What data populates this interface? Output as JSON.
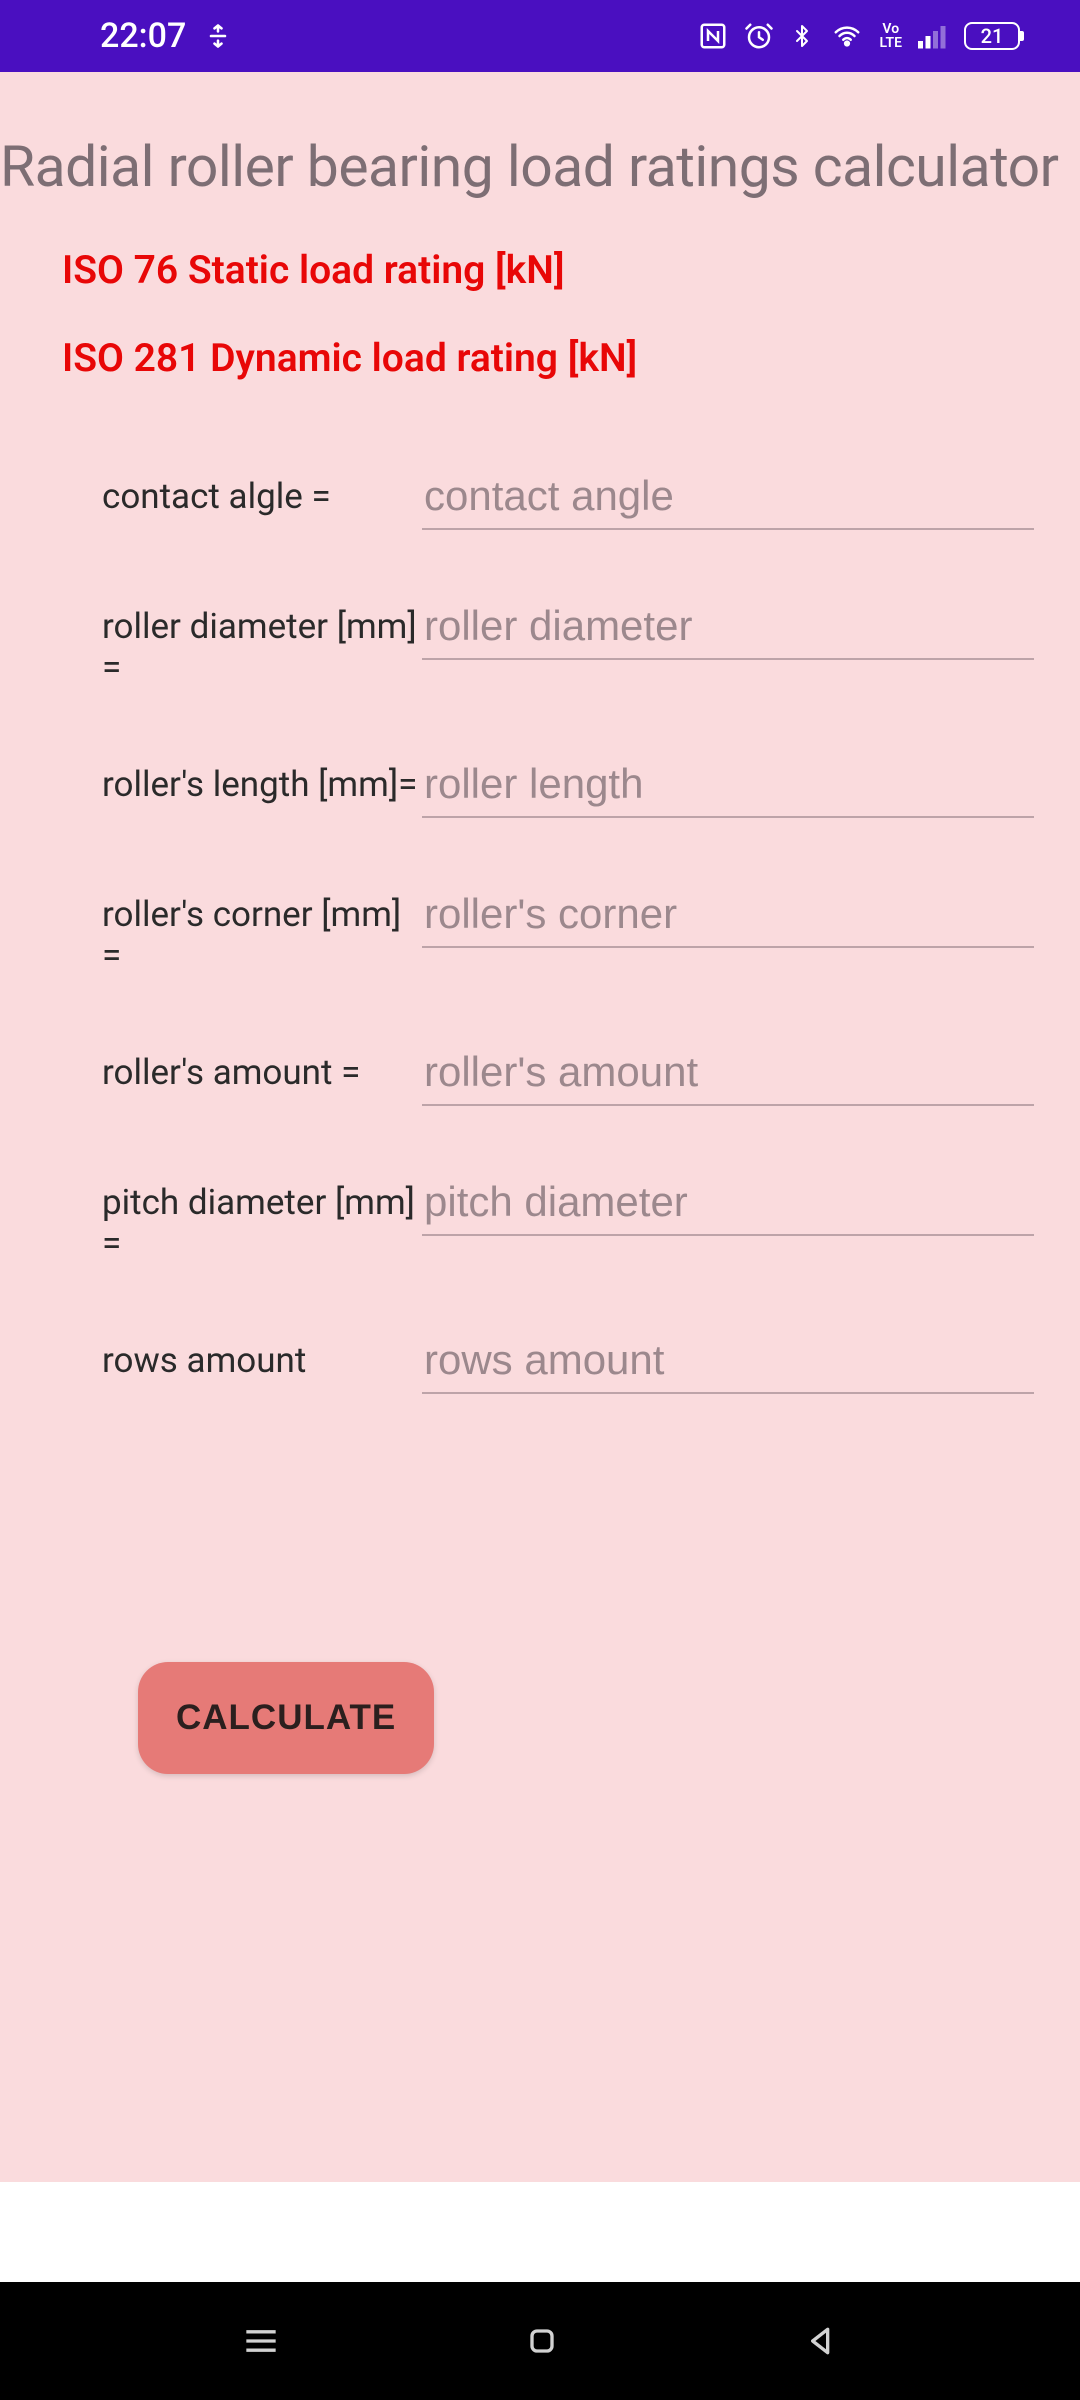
{
  "status": {
    "time": "22:07",
    "battery": "21"
  },
  "header": {
    "title": "Radial roller bearing load ratings calculator"
  },
  "outputs": {
    "static": "ISO 76 Static load rating [kN]",
    "dynamic": "ISO 281 Dynamic load rating [kN]"
  },
  "fields": [
    {
      "label": "contact algle =",
      "placeholder": "contact angle",
      "value": ""
    },
    {
      "label": "roller diameter [mm] =",
      "placeholder": "roller diameter",
      "value": ""
    },
    {
      "label": "roller's length [mm]=",
      "placeholder": "roller length",
      "value": ""
    },
    {
      "label": "roller's corner [mm] =",
      "placeholder": "roller's corner",
      "value": ""
    },
    {
      "label": "roller's amount =",
      "placeholder": "roller's amount",
      "value": ""
    },
    {
      "label": "pitch diameter [mm] =",
      "placeholder": "pitch diameter",
      "value": ""
    },
    {
      "label": "rows amount",
      "placeholder": "rows amount",
      "value": ""
    }
  ],
  "button": {
    "calculate": "CALCULATE"
  }
}
